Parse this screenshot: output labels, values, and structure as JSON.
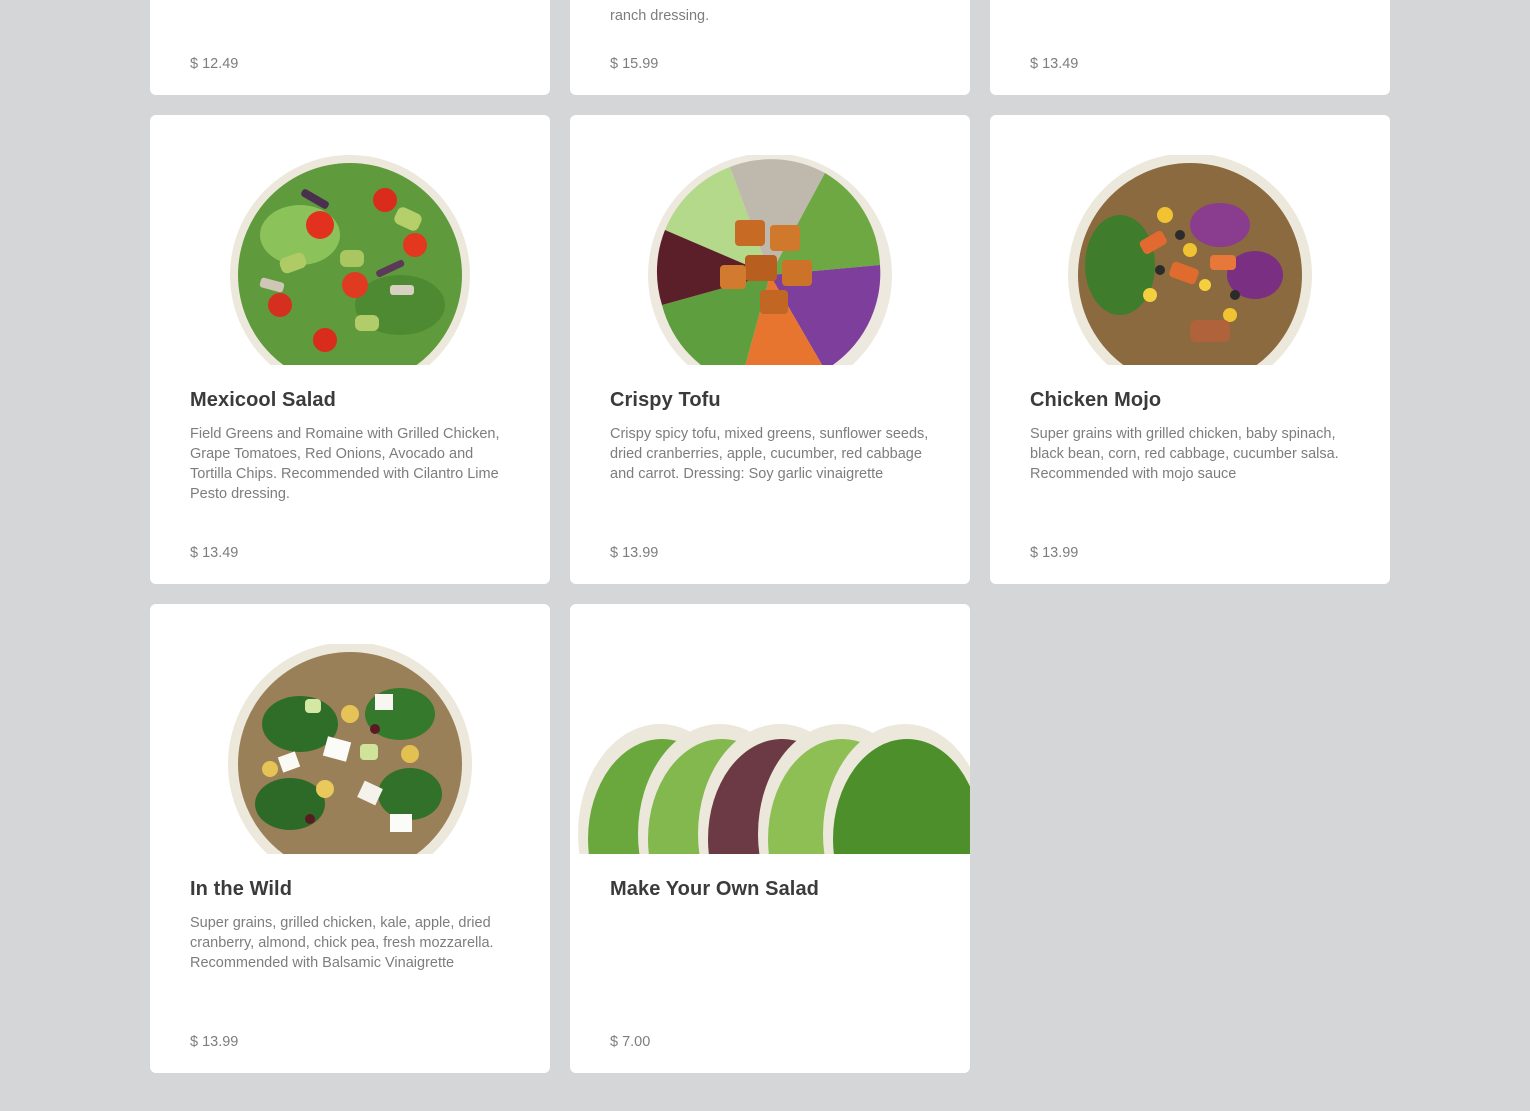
{
  "menu": {
    "items": [
      {
        "id": "item-1",
        "name": "",
        "description": "",
        "currency": "$",
        "price": "12.49",
        "image": "salad-bowl-image"
      },
      {
        "id": "item-2",
        "name": "",
        "description": "ranch dressing.",
        "currency": "$",
        "price": "15.99",
        "image": "salad-bowl-image"
      },
      {
        "id": "item-3",
        "name": "",
        "description": "",
        "currency": "$",
        "price": "13.49",
        "image": "salad-bowl-image"
      },
      {
        "id": "mexicool-salad",
        "name": "Mexicool Salad",
        "description": "Field Greens and Romaine with Grilled Chicken, Grape Tomatoes, Red Onions, Avocado and Tortilla Chips. Recommended with Cilantro Lime Pesto dressing.",
        "currency": "$",
        "price": "13.49",
        "image": "mexicool-salad-bowl-image"
      },
      {
        "id": "crispy-tofu",
        "name": "Crispy Tofu",
        "description": "Crispy spicy tofu, mixed greens, sunflower seeds, dried cranberries, apple, cucumber, red cabbage and carrot. Dressing: Soy garlic vinaigrette",
        "currency": "$",
        "price": "13.99",
        "image": "crispy-tofu-bowl-image"
      },
      {
        "id": "chicken-mojo",
        "name": "Chicken Mojo",
        "description": "Super grains with grilled chicken, baby spinach, black bean, corn, red cabbage, cucumber salsa. Recommended with mojo sauce",
        "currency": "$",
        "price": "13.99",
        "image": "chicken-mojo-bowl-image"
      },
      {
        "id": "in-the-wild",
        "name": "In the Wild",
        "description": "Super grains, grilled chicken, kale, apple, dried cranberry, almond, chick pea, fresh mozzarella. Recommended with Balsamic Vinaigrette",
        "currency": "$",
        "price": "13.99",
        "image": "in-the-wild-bowl-image"
      },
      {
        "id": "make-your-own-salad",
        "name": "Make Your Own Salad",
        "description": "",
        "currency": "$",
        "price": "7.00",
        "image": "greens-bowls-image"
      }
    ]
  },
  "colors": {
    "page_background": "#d5d6d8",
    "card_background": "#ffffff",
    "title_text": "#3b3b3b",
    "body_text": "#7d7d7d"
  }
}
